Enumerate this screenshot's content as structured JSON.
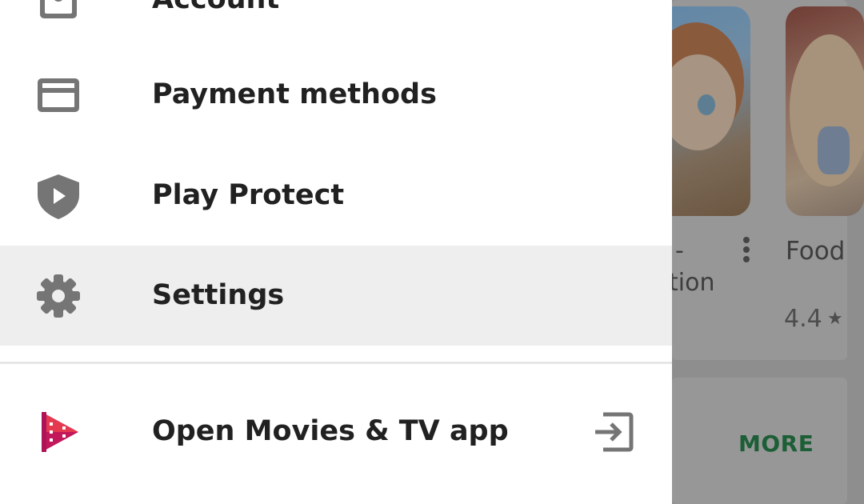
{
  "drawer": {
    "items": [
      {
        "label": "Account",
        "icon": "account-icon"
      },
      {
        "label": "Payment methods",
        "icon": "credit-card-icon"
      },
      {
        "label": "Play Protect",
        "icon": "shield-play-icon"
      },
      {
        "label": "Settings",
        "icon": "gear-icon",
        "selected": true
      }
    ],
    "app_link": {
      "label": "Open Movies & TV app",
      "icon": "play-movies-icon",
      "trailing_icon": "open-external-icon"
    }
  },
  "background": {
    "app_title_fragment_1": "-",
    "app_title_fragment_2": "tion",
    "app_title_2": "Food",
    "rating_2": "4.4",
    "star": "★",
    "more_label": "MORE"
  },
  "colors": {
    "drawer_bg": "#ffffff",
    "selected_bg": "#eeeeee",
    "icon_gray": "#757575",
    "movies_red": "#c2185b",
    "more_green": "#1c5e35",
    "scrim": "#8e8e8e"
  }
}
